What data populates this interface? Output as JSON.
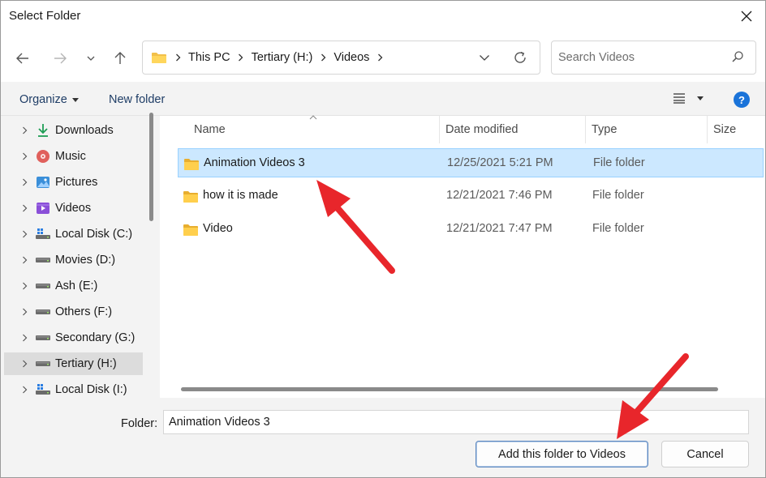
{
  "window": {
    "title": "Select Folder"
  },
  "address": {
    "crumbs": [
      "This PC",
      "Tertiary (H:)",
      "Videos"
    ]
  },
  "search": {
    "placeholder": "Search Videos"
  },
  "toolbar": {
    "organize": "Organize",
    "new_folder": "New folder",
    "help": "?"
  },
  "sidebar": {
    "items": [
      {
        "label": "Downloads",
        "icon": "download-icon"
      },
      {
        "label": "Music",
        "icon": "music-icon"
      },
      {
        "label": "Pictures",
        "icon": "pictures-icon"
      },
      {
        "label": "Videos",
        "icon": "videos-icon"
      },
      {
        "label": "Local Disk (C:)",
        "icon": "system-drive-icon"
      },
      {
        "label": "Movies (D:)",
        "icon": "drive-icon"
      },
      {
        "label": "Ash (E:)",
        "icon": "drive-icon"
      },
      {
        "label": "Others (F:)",
        "icon": "drive-icon"
      },
      {
        "label": "Secondary (G:)",
        "icon": "drive-icon"
      },
      {
        "label": "Tertiary (H:)",
        "icon": "drive-icon",
        "selected": true
      },
      {
        "label": "Local Disk (I:)",
        "icon": "system-drive-icon"
      }
    ]
  },
  "columns": {
    "name": "Name",
    "date": "Date modified",
    "type": "Type",
    "size": "Size"
  },
  "files": [
    {
      "name": "Animation Videos 3",
      "date": "12/25/2021 5:21 PM",
      "type": "File folder",
      "selected": true
    },
    {
      "name": "how it is made",
      "date": "12/21/2021 7:46 PM",
      "type": "File folder"
    },
    {
      "name": "Video",
      "date": "12/21/2021 7:47 PM",
      "type": "File folder"
    }
  ],
  "footer": {
    "folder_label": "Folder:",
    "folder_value": "Animation Videos 3",
    "add_button": "Add this folder to Videos",
    "cancel_button": "Cancel"
  },
  "colors": {
    "accent": "#1a73d9",
    "selection": "#cce8ff",
    "annotation_arrow": "#e8262b",
    "folder": "#f2c04a"
  }
}
